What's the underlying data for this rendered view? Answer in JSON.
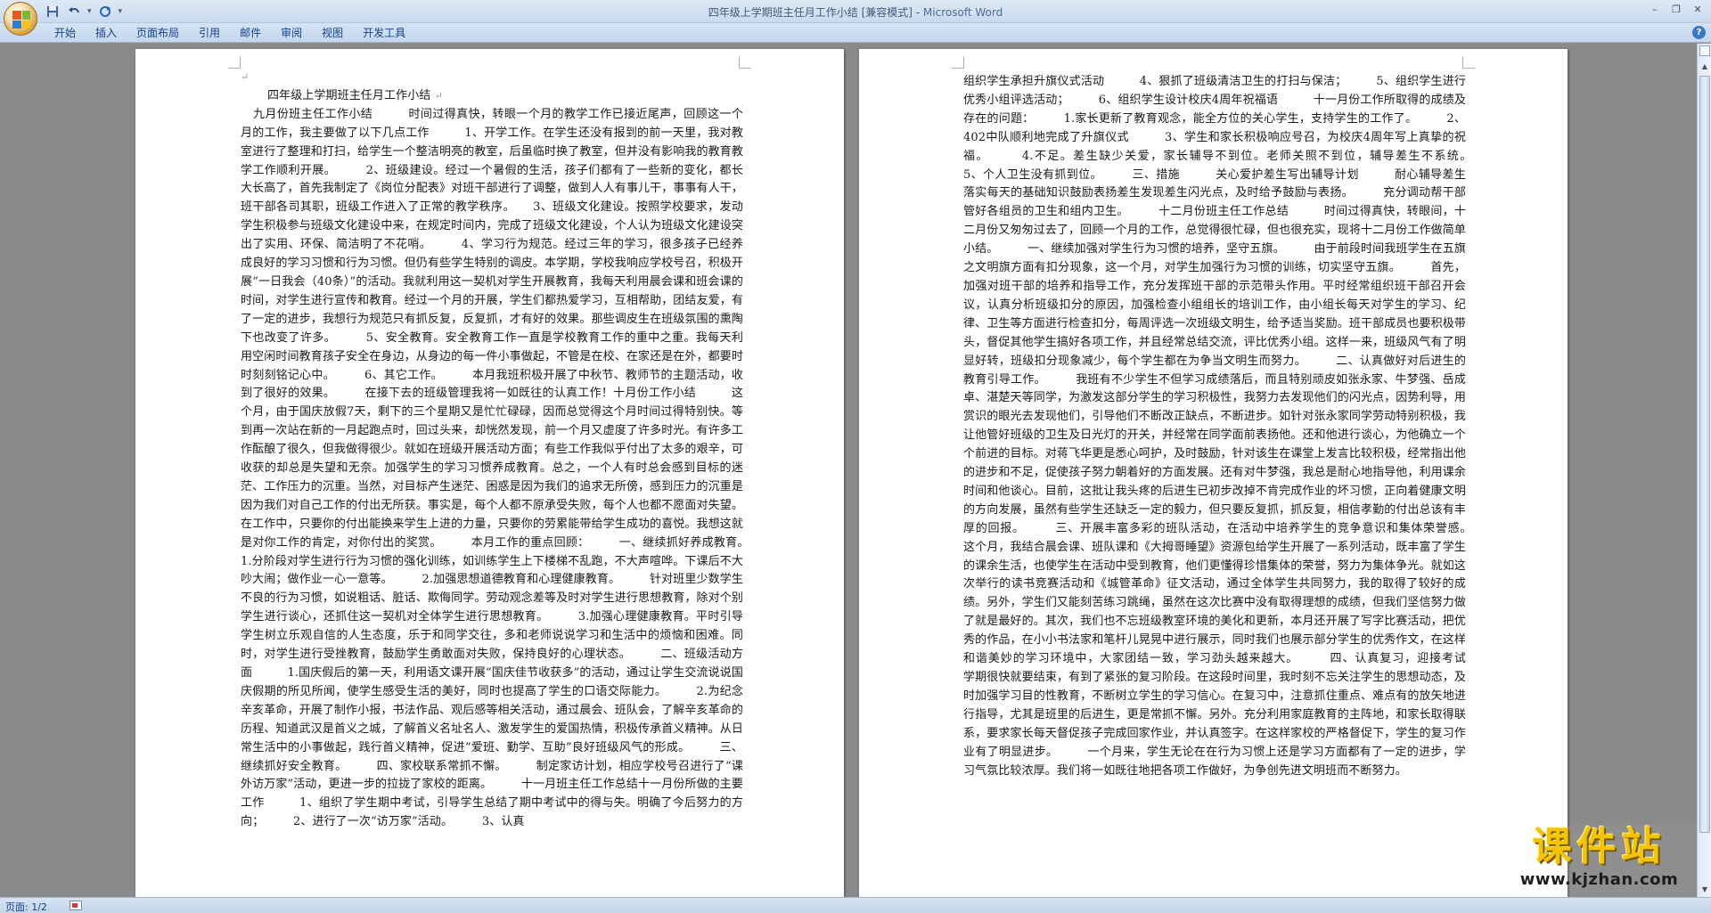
{
  "window": {
    "title": "四年级上学期班主任月工作小结 [兼容模式] - ",
    "app_name": "Microsoft Word"
  },
  "ribbon": {
    "tabs": [
      "开始",
      "插入",
      "页面布局",
      "引用",
      "邮件",
      "审阅",
      "视图",
      "开发工具"
    ]
  },
  "document": {
    "title": "四年级上学期班主任月工作小结",
    "page1_text": "九月份班主任工作小结　　　时间过得真快，转眼一个月的教学工作已接近尾声，回顾这一个月的工作，我主要做了以下几点工作　　　1、开学工作。在学生还没有报到的前一天里，我对教室进行了整理和打扫，给学生一个整洁明亮的教室，后虽临时换了教室，但并没有影响我的教育教学工作顺利开展。　　　2、班级建设。经过一个暑假的生活，孩子们都有了一些新的变化，都长大长高了，首先我制定了《岗位分配表》对班干部进行了调整，做到人人有事儿干，事事有人干，班干部各司其职，班级工作进入了正常的教学秩序。　　3、班级文化建设。按照学校要求，发动学生积极参与班级文化建设中来，在规定时间内，完成了班级文化建设，个人认为班级文化建设突出了实用、环保、简洁明了不花哨。　　　4、学习行为规范。经过三年的学习，很多孩子已经养成良好的学习习惯和行为习惯。但仍有些学生特别的调皮。本学期，学校我响应学校号召，积极开展“一日我会（40条）”的活动。我就利用这一契机对学生开展教育，我每天利用晨会课和班会课的时间，对学生进行宣传和教育。经过一个月的开展，学生们都热爱学习，互相帮助，团结友爱，有了一定的进步，我想行为规范只有抓反复，反复抓，才有好的效果。那些调皮生在班级氛围的熏陶下也改变了许多。　　　5、安全教育。安全教育工作一直是学校教育工作的重中之重。我每天利用空闲时间教育孩子安全在身边，从身边的每一件小事做起，不管是在校、在家还是在外，都要时时刻刻铭记心中。　　　6、其它工作。　　　本月我班积极开展了中秋节、教师节的主题活动，收到了很好的效果。　　　在接下去的班级管理我将一如既往的认真工作！十月份工作小结　　　这个月，由于国庆放假7天，剩下的三个星期又是忙忙碌碌，因而总觉得这个月时间过得特别快。等到再一次站在新的一月起跑点时，回过头来，却恍然发现，前一个月又虚度了许多时光。有许多工作酝酿了很久，但我做得很少。就如在班级开展活动方面；有些工作我似乎付出了太多的艰辛，可收获的却总是失望和无奈。加强学生的学习习惯养成教育。总之，一个人有时总会感到目标的迷茫、工作压力的沉重。当然，对目标产生迷茫、困惑是因为我们的追求无所傍，感到压力的沉重是因为我们对自己工作的付出无所获。事实是，每个人都不原承受失败，每个人也都不愿面对失望。在工作中，只要你的付出能换来学生上进的力量，只要你的劳累能带给学生成功的喜悦。我想这就是对你工作的肯定，对你付出的奖赏。　　　本月工作的重点回顾：　　　一、继续抓好养成教育。　　　1.分阶段对学生进行行为习惯的强化训练，如训练学生上下楼梯不乱跑，不大声喧哗。下课后不大吵大闹；做作业一心一意等。　　　2.加强思想道德教育和心理健康教育。　　　针对班里少数学生不良的行为习惯，如说粗话、脏话、欺侮同学。劳动观念差等及时对学生进行思想教育，除对个别学生进行谈心，还抓住这一契机对全体学生进行思想教育。　　　3.加强心理健康教育。平时引导学生树立乐观自信的人生态度，乐于和同学交往，多和老师说说学习和生活中的烦恼和困难。同时，对学生进行受挫教育，鼓励学生勇敢面对失败，保持良好的心理状态。　　　二、班级活动方面　　　1.国庆假后的第一天，利用语文课开展“国庆佳节收获多”的活动，通过让学生交流说说国庆假期的所见所闻，使学生感受生活的美好，同时也提高了学生的口语交际能力。　　　2.为纪念辛亥革命，开展了制作小报，书法作品、观后感等相关活动，通过晨会、班队会，了解辛亥革命的历程、知道武汉是首义之城，了解首义名址名人、激发学生的爱国热情，积极传承首义精神。从日常生活中的小事做起，践行首义精神，促进“爱班、勤学、互助”良好班级风气的形成。　　　三、继续抓好安全教育。　　　四、家校联系常抓不懈。　　　制定家访计划，相应学校号召进行了“课外访万家”活动，更进一步的拉拢了家校的距离。　　　十一月班主任工作总结十一月份所做的主要工作　　　1、组织了学生期中考试，引导学生总结了期中考试中的得与失。明确了今后努力的方向；　　　2、进行了一次“访万家”活动。　　　3、认真",
    "page2_text": "组织学生承担升旗仪式活动　　　4、狠抓了班级清洁卫生的打扫与保洁；　　　5、组织学生进行优秀小组评选活动；　　　6、组织学生设计校庆4周年祝福语　　　十一月份工作所取得的成绩及存在的问题：　　　1.家长更新了教育观念，能全方位的关心学生，支持学生的工作了。　　　2、402中队顺利地完成了升旗仪式　　　3、学生和家长积极响应号召，为校庆4周年写上真挚的祝福。　　　4.不足。差生缺少关爱，家长辅导不到位。老师关照不到位，辅导差生不系统。　　　5、个人卫生没有抓到位。　　　三、措施　　　关心爱护差生写出辅导计划　　　耐心辅导差生落实每天的基础知识鼓励表扬差生发现差生闪光点，及时给予鼓励与表扬。　　　充分调动帮干部管好各组员的卫生和组内卫生。　　　十二月份班主任工作总结　　　时间过得真快，转眼间，十二月份又匆匆过去了，回顾一个月的工作，总觉得很忙碌，但也很充实，现将十二月份工作做简单小结。　　　一、继续加强对学生行为习惯的培养，坚守五旗。　　　由于前段时间我班学生在五旗之文明旗方面有扣分现象，这一个月，对学生加强行为习惯的训练，切实坚守五旗。　　　首先，加强对班干部的培养和指导工作，充分发挥班干部的示范带头作用。平时经常组织班干部召开会议，认真分析班级扣分的原因，加强检查小组组长的培训工作，由小组长每天对学生的学习、纪律、卫生等方面进行检查扣分，每周评选一次班级文明生，给予适当奖励。班干部成员也要积极带头，督促其他学生搞好各项工作，并且经常总结交流，评比优秀小组。这样一来，班级风气有了明显好转，班级扣分现象减少，每个学生都在为争当文明生而努力。　　　二、认真做好对后进生的教育引导工作。　　　我班有不少学生不但学习成绩落后，而且特别顽皮如张永家、牛梦强、岳成卓、湛楚天等同学，为激发这部分学生的学习积极性，我努力去发现他们的闪光点，因势利导，用赏识的眼光去发现他们，引导他们不断改正缺点，不断进步。如针对张永家同学劳动特别积极，我让他管好班级的卫生及日光灯的开关，并经常在同学面前表扬他。还和他进行谈心，为他确立一个个前进的目标。对蒋飞华更是悉心呵护，及时鼓励，针对该生在课堂上发言比较积极，经常指出他的进步和不足，促使孩子努力朝着好的方面发展。还有对牛梦强，我总是耐心地指导他，利用课余时间和他谈心。目前，这批让我头疼的后进生已初步改掉不肯完成作业的坏习惯，正向着健康文明的方向发展，虽然有些学生还缺乏一定的毅力，但只要反复抓，抓反复，相信孝勤的付出总该有丰厚的回报。　　　三、开展丰富多彩的班队活动，在活动中培养学生的竞争意识和集体荣誉感。　　　这个月，我结合晨会课、班队课和《大拇哥睡望》资源包给学生开展了一系列活动，既丰富了学生的课余生活，也使学生在活动中受到教育，他们更懂得珍惜集体的荣誉，努力为集体争光。就如这次举行的读书竞赛活动和《城管革命》征文活动，通过全体学生共同努力，我的取得了较好的成绩。另外，学生们又能刻苦练习跳绳，虽然在这次比赛中没有取得理想的成绩，但我们坚信努力做了就是最好的。其次，我们也不忘班级教室环境的美化和更新，本月还开展了写字比赛活动，把优秀的作品，在小小书法家和笔杆儿晃晃中进行展示，同时我们也展示部分学生的优秀作文，在这样和谐美妙的学习环境中，大家团结一致，学习劲头越来越大。　　　四、认真复习，迎接考试　　　学期很快就要结束，有到了紧张的复习阶段。在这段时间里，我时刻不忘关注学生的思想动态，及时加强学习目的性教育，不断树立学生的学习信心。在复习中，注意抓住重点、难点有的放矢地进行指导，尤其是班里的后进生，更是常抓不懈。另外。充分利用家庭教育的主阵地，和家长取得联系，要求家长每天督促孩子完成回家作业，并认真签字。在这样家校的严格督促下，学生的复习作业有了明显进步。　　　一个月来，学生无论在在行为习惯上还是学习方面都有了一定的进步，学习气氛比较浓厚。我们将一如既往地把各项工作做好，为争创先进文明班而不断努力。"
  },
  "status": {
    "pages": "页面: 1/2"
  },
  "watermark": {
    "name": "课件站",
    "url": "www.kjzhan.com"
  },
  "colors": {
    "title_bar": "#c9daef",
    "ribbon_text": "#15428b",
    "workspace": "#8a8a8a",
    "watermark_gold": "#f4c400"
  }
}
